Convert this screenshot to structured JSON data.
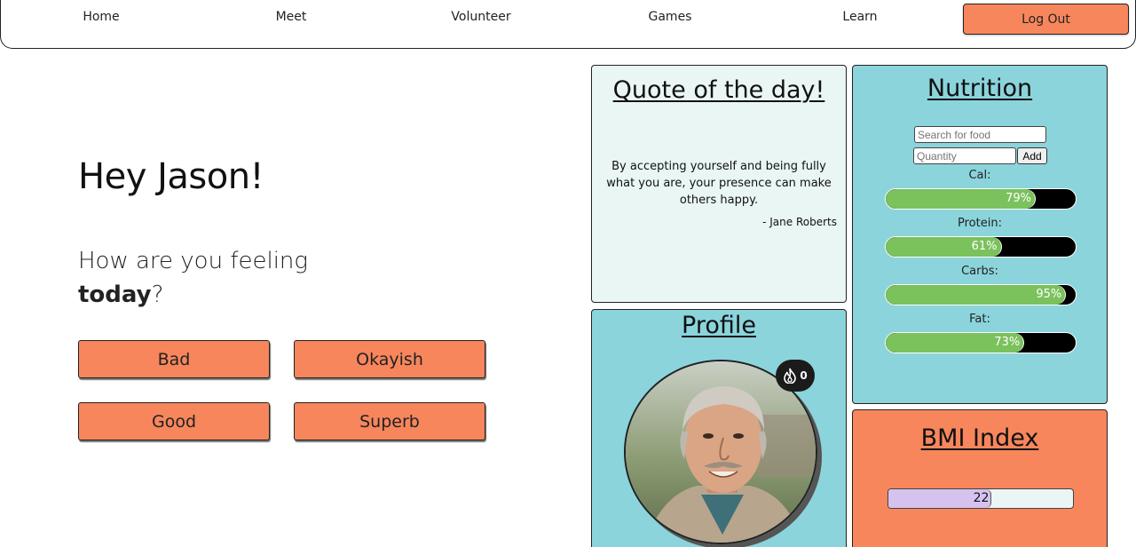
{
  "nav": {
    "home": "Home",
    "meet": "Meet",
    "volunteer": "Volunteer",
    "games": "Games",
    "learn": "Learn",
    "logout": "Log Out"
  },
  "greeting": "Hey Jason!",
  "feeling": {
    "prefix": "How are you feeling",
    "bold": "today",
    "suffix": "?"
  },
  "moods": [
    "Bad",
    "Okayish",
    "Good",
    "Superb"
  ],
  "quote": {
    "title": "Quote of the day!",
    "text": "By accepting yourself and being fully what you are, your presence can make others happy.",
    "author": "- Jane Roberts"
  },
  "profile": {
    "title": "Profile",
    "streak": "0"
  },
  "nutrition": {
    "title": "Nutrition",
    "search_placeholder": "Search for food",
    "quantity_placeholder": "Quantity",
    "add_label": "Add",
    "items": [
      {
        "label": "Cal:",
        "value": 79,
        "text": "79%"
      },
      {
        "label": "Protein:",
        "value": 61,
        "text": "61%"
      },
      {
        "label": "Carbs:",
        "value": 95,
        "text": "95%"
      },
      {
        "label": "Fat:",
        "value": 73,
        "text": "73%"
      }
    ]
  },
  "bmi": {
    "title": "BMI Index",
    "value": "22",
    "fill_fraction": 0.56
  },
  "colors": {
    "accent": "#f7865c",
    "panel_teal": "#8bd4dc",
    "bar_green": "#7bc15c",
    "quote_bg": "#e9f6f4",
    "bmi_fill": "#d6c2ef"
  }
}
